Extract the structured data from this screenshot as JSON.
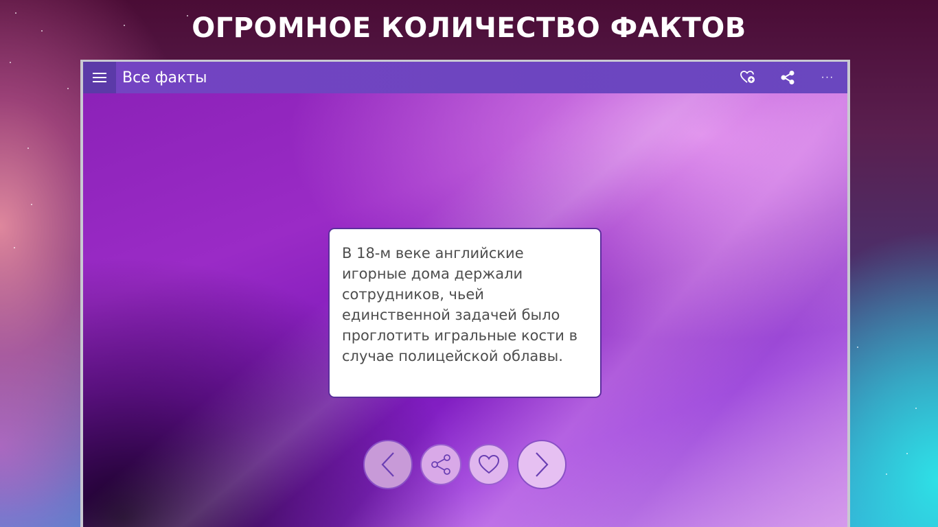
{
  "headline": "ОГРОМНОЕ КОЛИЧЕСТВО ФАКТОВ",
  "app": {
    "title": "Все факты",
    "toolbar": {
      "favorites_icon": "heart-plus-icon",
      "share_icon": "share-icon",
      "more_label": "···"
    }
  },
  "fact": {
    "text": "В 18-м веке английские игорные дома держали сотрудников, чьей единственной задачей было проглотить игральные кости в случае полицейской облавы."
  },
  "controls": {
    "prev_icon": "chevron-left-icon",
    "share_icon": "share-icon",
    "like_icon": "heart-icon",
    "next_icon": "chevron-right-icon"
  },
  "colors": {
    "titlebar": "#6d45c0",
    "accent": "#7a3fd0",
    "card_border": "#5b2f9c"
  }
}
